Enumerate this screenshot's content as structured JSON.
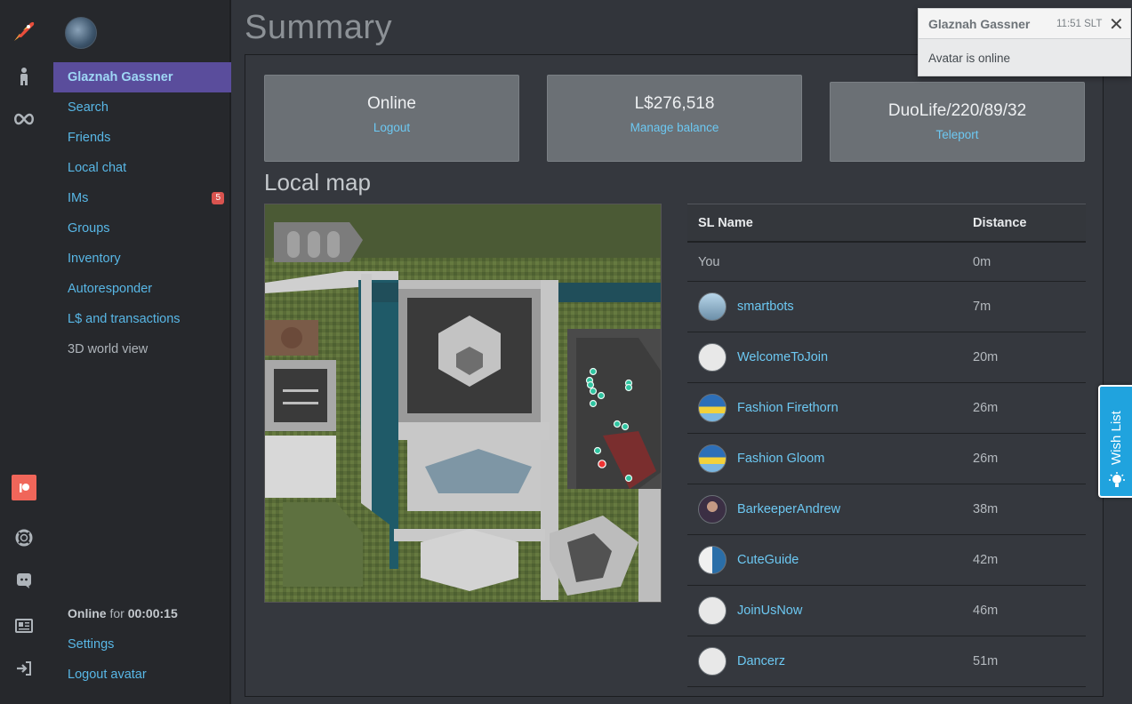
{
  "sidebar": {
    "user_name": "Glaznah Gassner",
    "items": [
      {
        "label": "Search"
      },
      {
        "label": "Friends"
      },
      {
        "label": "Local chat"
      },
      {
        "label": "IMs",
        "badge": "5"
      },
      {
        "label": "Groups"
      },
      {
        "label": "Inventory"
      },
      {
        "label": "Autoresponder"
      },
      {
        "label": "L$ and transactions"
      },
      {
        "label": "3D world view"
      }
    ],
    "status_label": "Online",
    "status_for": "for",
    "status_time": "00:00:15",
    "settings": "Settings",
    "logout_avatar": "Logout avatar"
  },
  "iconbar": {
    "icons": [
      "rocket-icon",
      "person-icon",
      "infinity-icon",
      "patreon-icon",
      "lifebuoy-icon",
      "discord-icon",
      "id-card-icon",
      "logout-icon"
    ]
  },
  "main": {
    "title": "Summary",
    "cards": [
      {
        "value": "Online",
        "link": "Logout"
      },
      {
        "value": "L$276,518",
        "link": "Manage balance"
      },
      {
        "value": "DuoLife/220/89/32",
        "link": "Teleport"
      }
    ],
    "map_title": "Local map"
  },
  "table": {
    "headers": [
      "SL Name",
      "Distance"
    ],
    "rows": [
      {
        "name": "You",
        "distance": "0m"
      },
      {
        "name": "smartbots",
        "distance": "7m"
      },
      {
        "name": "WelcomeToJoin",
        "distance": "20m"
      },
      {
        "name": "Fashion Firethorn",
        "distance": "26m"
      },
      {
        "name": "Fashion Gloom",
        "distance": "26m"
      },
      {
        "name": "BarkeeperAndrew",
        "distance": "38m"
      },
      {
        "name": "CuteGuide",
        "distance": "42m"
      },
      {
        "name": "JoinUsNow",
        "distance": "46m"
      },
      {
        "name": "Dancerz",
        "distance": "51m"
      }
    ]
  },
  "toast": {
    "title": "Glaznah Gassner",
    "time": "11:51 SLT",
    "close": "✕",
    "body": "Avatar is online"
  },
  "wishlist": {
    "label": "Wish List"
  },
  "colors": {
    "accent": "#5a4d9c",
    "link": "#58b7e6",
    "badge": "#d9534f",
    "wish_tab": "#20a3de"
  }
}
